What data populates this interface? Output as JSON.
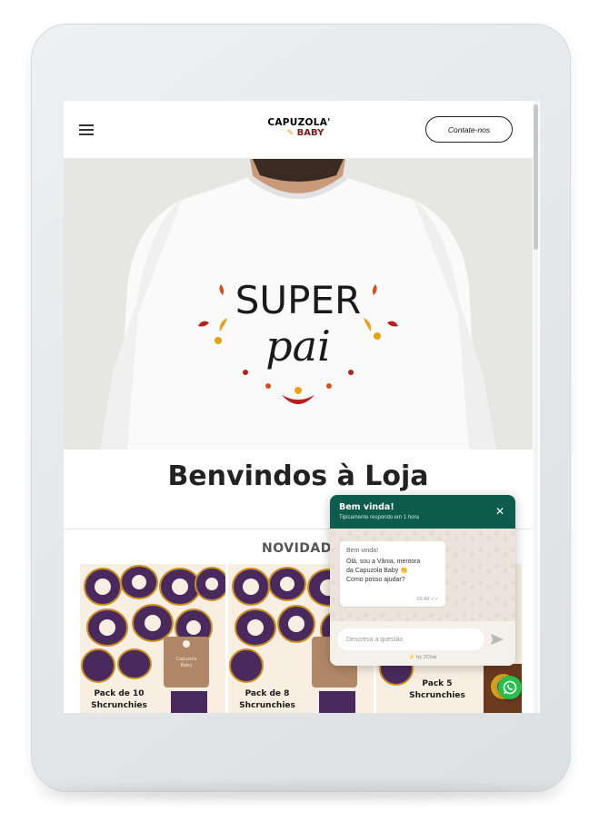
{
  "header": {
    "logo_top": "CAPUZOLA'",
    "logo_bottom": "BABY",
    "contact_label": "Contate-nos"
  },
  "hero": {
    "shirt_text_line1": "SUPER",
    "shirt_text_line2": "pai"
  },
  "main": {
    "welcome_title": "Benvindos à Loja",
    "section_title": "NOVIDADES"
  },
  "products": [
    {
      "label": "Pack de 10\nShcrunchies"
    },
    {
      "label": "Pack de 8\nShcrunchies"
    },
    {
      "label": "Pack 5\nShcrunchies"
    }
  ],
  "chat": {
    "title": "Bem vinda!",
    "subtitle": "Tipicamente respondo em 1 hora",
    "sender": "Bem vinda!",
    "message": "Olá, sou a Vânia, mentora\nda Capuzola Baby 👏\nComo posso ajudar?",
    "time": "03:49",
    "input_placeholder": "Descreva a questão",
    "powered_by": "⚡ by 2Chat"
  },
  "colors": {
    "chat_header": "#0d5c4e",
    "whatsapp": "#25c04a",
    "brand_red": "#7a1a1a"
  }
}
